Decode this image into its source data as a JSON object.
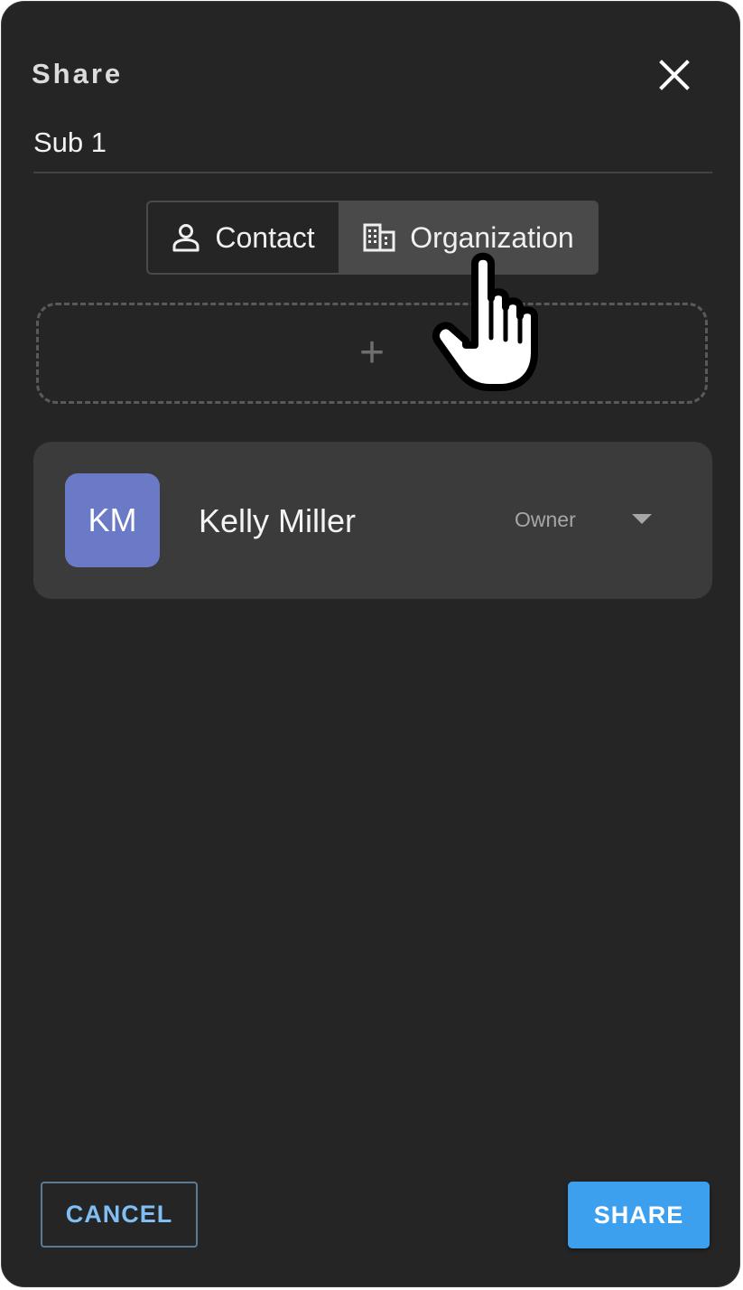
{
  "dialog": {
    "title": "Share",
    "subject": "Sub 1"
  },
  "tabs": [
    {
      "label": "Contact",
      "icon": "person-icon",
      "selected": false
    },
    {
      "label": "Organization",
      "icon": "building-icon",
      "selected": true
    }
  ],
  "add_area": {
    "icon": "plus-icon",
    "symbol": "+"
  },
  "members": [
    {
      "initials": "KM",
      "name": "Kelly Miller",
      "role": "Owner",
      "avatar_color": "#6a7ac6"
    }
  ],
  "actions": {
    "cancel_label": "CANCEL",
    "share_label": "SHARE"
  },
  "colors": {
    "background": "#252525",
    "accent": "#3ca0ef",
    "card": "#3b3b3b"
  }
}
